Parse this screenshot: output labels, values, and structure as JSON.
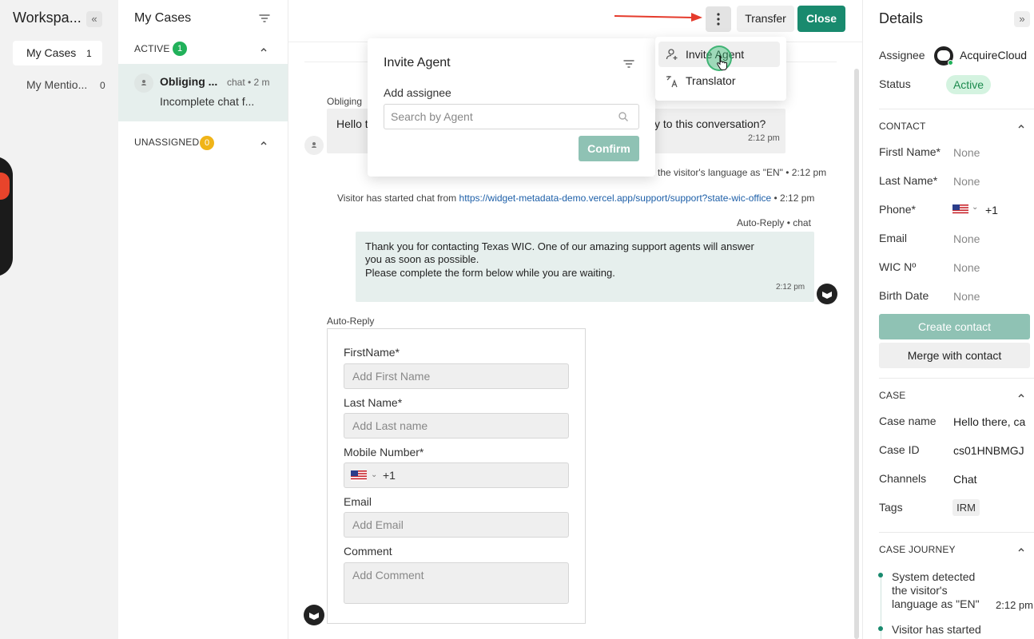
{
  "workspace": {
    "title": "Workspa...",
    "collapse_icon": "double-chevron-left",
    "nav": [
      {
        "label": "My Cases",
        "count": "1"
      },
      {
        "label": "My Mentio...",
        "count": "0"
      }
    ]
  },
  "cases": {
    "title": "My Cases",
    "active_label": "ACTIVE",
    "active_count": "1",
    "unassigned_label": "UNASSIGNED",
    "unassigned_count": "0",
    "item": {
      "name": "Obliging ...",
      "meta": "chat • 2 m",
      "preview": "Incomplete chat f..."
    }
  },
  "toolbar": {
    "more_icon": "vertical-dots",
    "transfer_label": "Transfer",
    "close_label": "Close"
  },
  "chat": {
    "visitor_name": "Obliging",
    "visitor_msg_start": "Hello t",
    "visitor_msg_end": "y to this conversation?",
    "visitor_time": "2:12 pm",
    "system_language": "cted the visitor's language as \"EN\" • 2:12 pm",
    "system_started_prefix": "Visitor has started chat from ",
    "system_started_link": "https://widget-metadata-demo.vercel.app/support/support?state-wic-office",
    "system_started_suffix": " • 2:12 pm",
    "autoreply_header": "Auto-Reply • chat",
    "autoreply_line1": "Thank you for contacting Texas WIC. One of our amazing support agents will answer",
    "autoreply_line2": "you as soon as possible.",
    "autoreply_line3": "Please complete the form below while you are waiting.",
    "autoreply_time": "2:12 pm",
    "form_header": "Auto-Reply"
  },
  "form": {
    "firstname_label": "FirstName*",
    "firstname_placeholder": "Add First Name",
    "lastname_label": "Last Name*",
    "lastname_placeholder": "Add Last name",
    "mobile_label": "Mobile Number*",
    "mobile_prefix": "+1",
    "email_label": "Email",
    "email_placeholder": "Add Email",
    "comment_label": "Comment",
    "comment_placeholder": "Add Comment"
  },
  "invite_popup": {
    "title": "Invite Agent",
    "add_label": "Add assignee",
    "search_placeholder": "Search by Agent",
    "confirm_label": "Confirm"
  },
  "more_menu": {
    "items": [
      {
        "label": "Invite Agent",
        "icon": "add-person-icon"
      },
      {
        "label": "Translator",
        "icon": "translate-icon"
      }
    ]
  },
  "details": {
    "title": "Details",
    "assignee_label": "Assignee",
    "assignee_value": "AcquireCloud",
    "status_label": "Status",
    "status_value": "Active",
    "contact_section": "CONTACT",
    "contact": [
      {
        "label": "Firstl Name*",
        "value": "None"
      },
      {
        "label": "Last Name*",
        "value": "None"
      },
      {
        "label": "Phone*",
        "value": "+1"
      },
      {
        "label": "Email",
        "value": "None"
      },
      {
        "label": "WIC Nº",
        "value": "None"
      },
      {
        "label": "Birth Date",
        "value": "None"
      }
    ],
    "create_contact_label": "Create contact",
    "merge_contact_label": "Merge with contact",
    "case_section": "CASE",
    "case": [
      {
        "label": "Case name",
        "value": "Hello there, ca"
      },
      {
        "label": "Case ID",
        "value": "cs01HNBMGJ"
      },
      {
        "label": "Channels",
        "value": "Chat"
      },
      {
        "label": "Tags",
        "value": "IRM"
      }
    ],
    "journey_section": "CASE JOURNEY",
    "journey": [
      {
        "text_1": "System detected",
        "text_2": "the visitor's",
        "text_3": "language as \"EN\"",
        "time": "2:12 pm"
      },
      {
        "text_1": "Visitor has started"
      }
    ]
  },
  "colors": {
    "accent": "#198a6e",
    "accent_light": "#8fc2b4",
    "active_badge": "#21b15a",
    "unassigned_badge": "#f0b418",
    "annotation_arrow": "#e53b2c"
  }
}
